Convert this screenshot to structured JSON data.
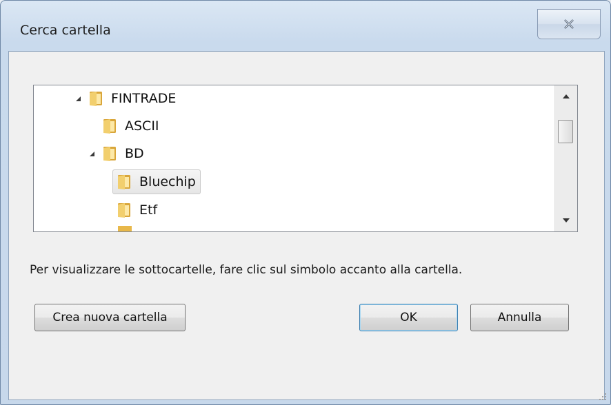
{
  "dialog": {
    "title": "Cerca cartella",
    "close_icon": "close-x-icon"
  },
  "tree": {
    "items": [
      {
        "label": "FINTRADE",
        "expanded": true,
        "selected": false
      },
      {
        "label": "ASCII",
        "expanded": false,
        "selected": false
      },
      {
        "label": "BD",
        "expanded": true,
        "selected": false
      },
      {
        "label": "Bluechip",
        "expanded": false,
        "selected": true
      },
      {
        "label": "Etf",
        "expanded": false,
        "selected": false
      }
    ]
  },
  "hint": "Per visualizzare le sottocartelle, fare clic sul simbolo accanto alla cartella.",
  "buttons": {
    "new_folder": "Crea nuova cartella",
    "ok": "OK",
    "cancel": "Annulla"
  },
  "colors": {
    "folder": "#e8b84a",
    "accent": "#3c7fb1"
  }
}
